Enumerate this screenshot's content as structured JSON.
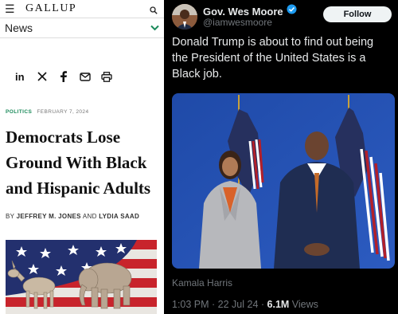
{
  "gallup": {
    "logo": "GALLUP",
    "nav_label": "News",
    "section": "POLITICS",
    "date": "FEBRUARY 7, 2024",
    "title": "Democrats Lose Ground With Black and Hispanic Adults",
    "by": "BY",
    "author1": "JEFFREY M. JONES",
    "and": "AND",
    "author2": "LYDIA SAAD",
    "share_icons": [
      "linkedin-icon",
      "x-icon",
      "facebook-icon",
      "email-icon",
      "print-icon"
    ]
  },
  "post": {
    "name": "Gov. Wes Moore",
    "handle": "@iamwesmoore",
    "follow_label": "Follow",
    "text": "Donald Trump is about to find out being the President of the United States is a Black job.",
    "caption": "Kamala Harris",
    "time": "1:03 PM · 22 Jul 24 · ",
    "views_count": "6.1M",
    "views_label": " Views",
    "verified_color": "#1d9bf0"
  }
}
